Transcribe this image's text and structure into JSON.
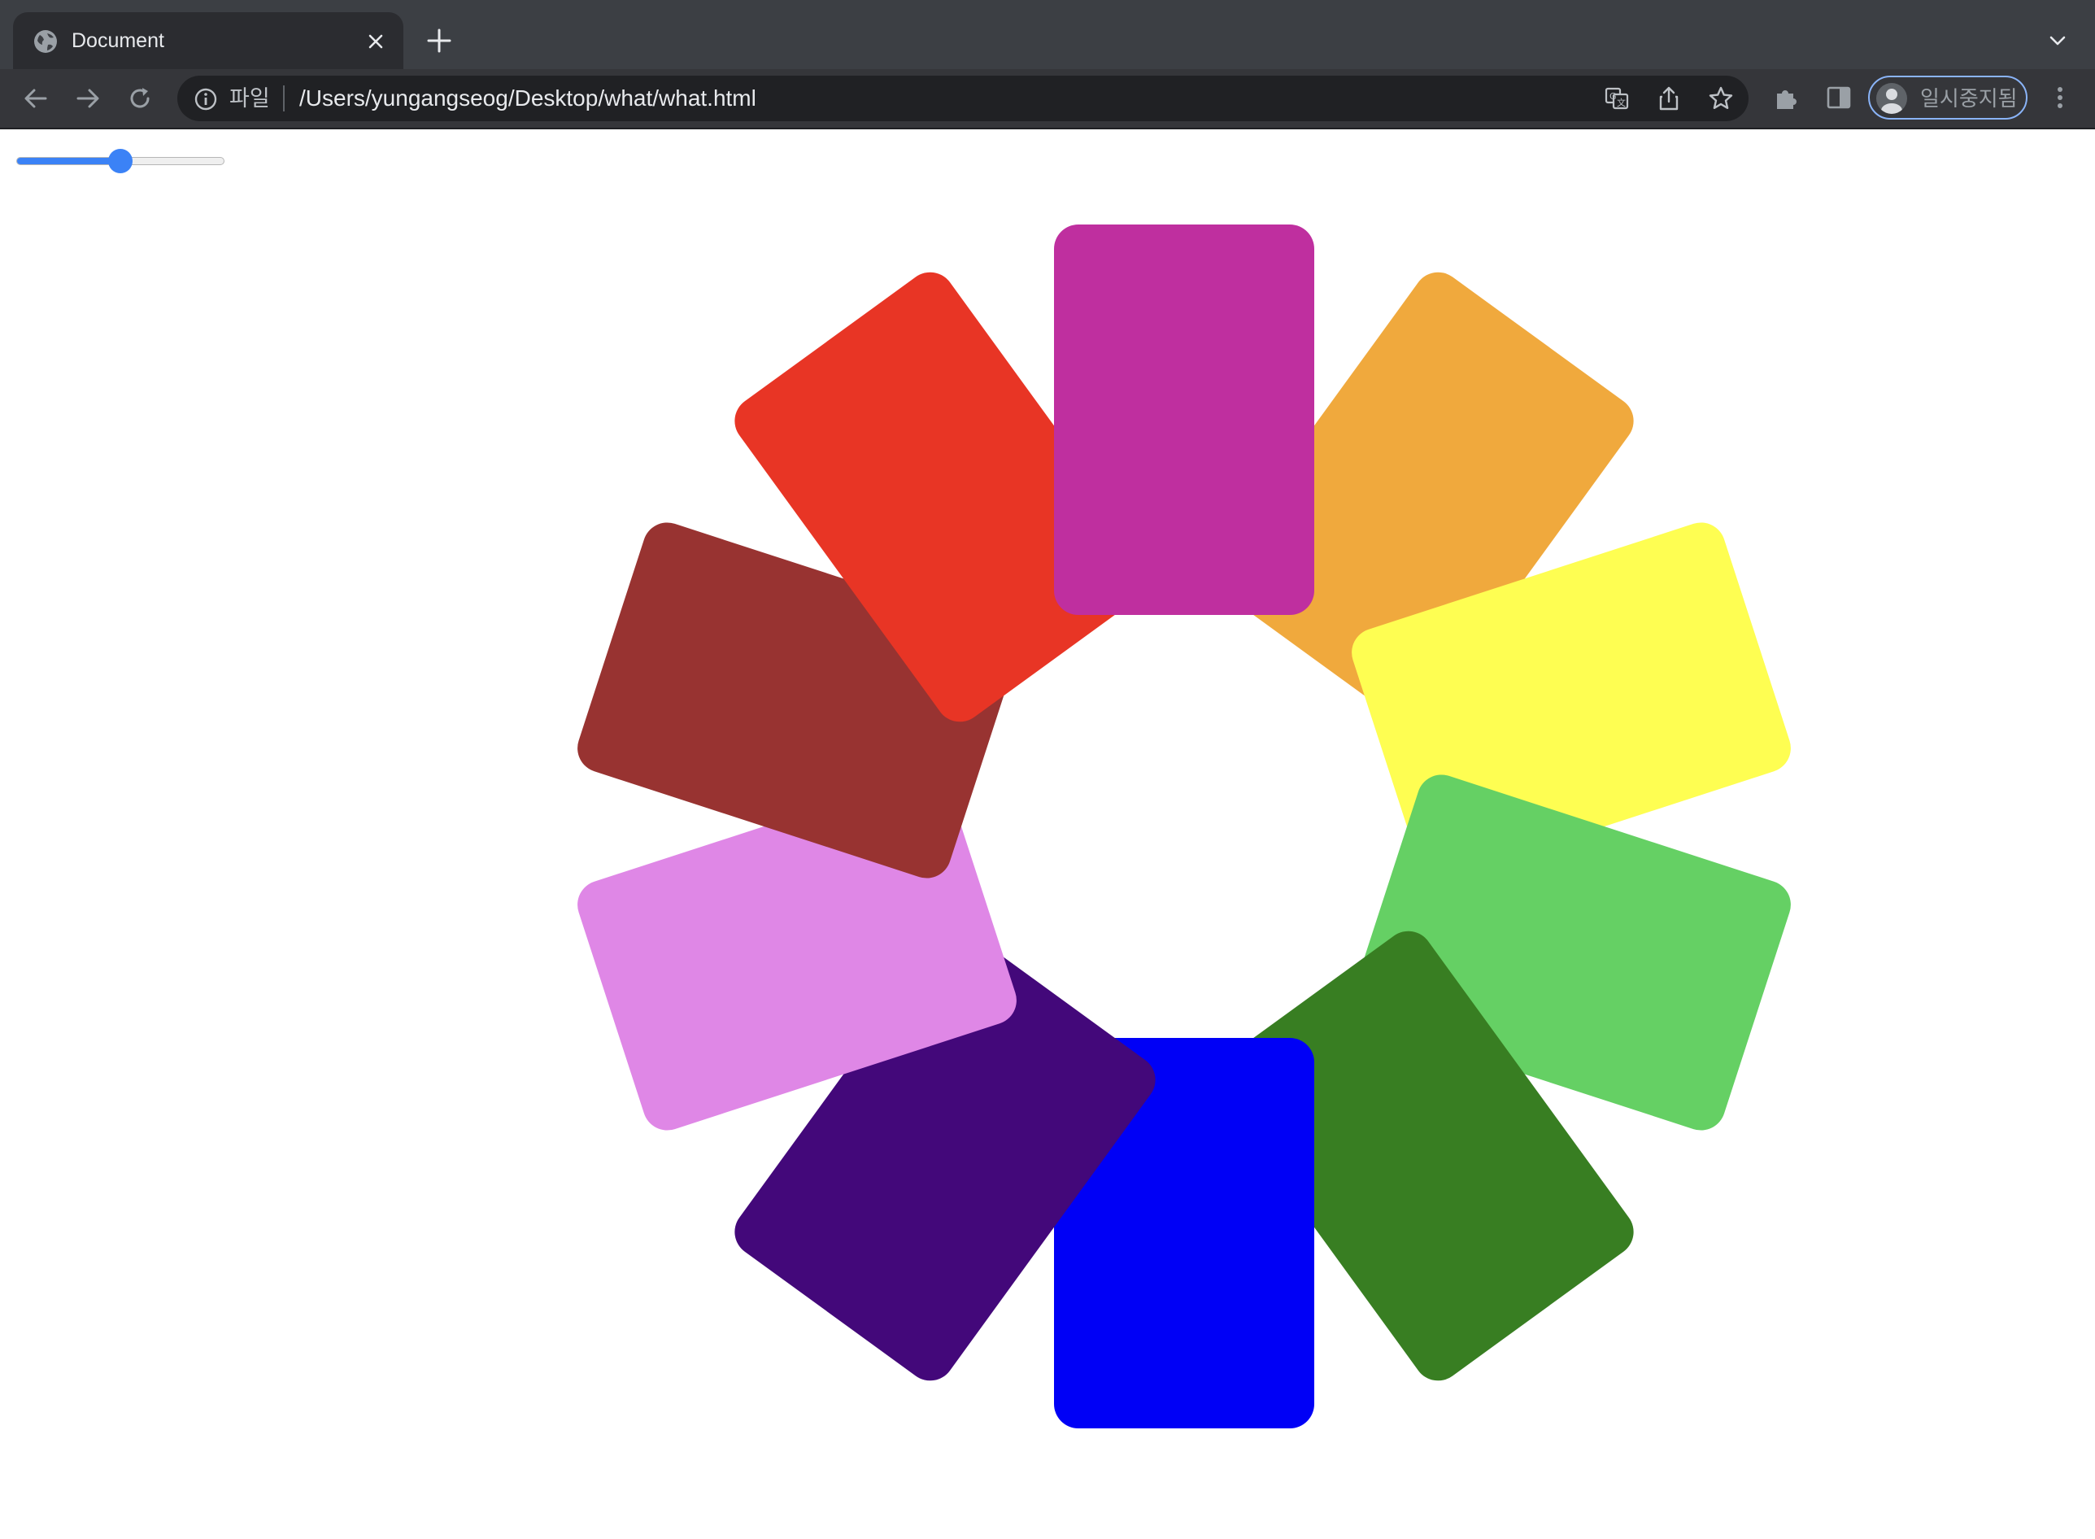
{
  "browser": {
    "tab": {
      "title": "Document"
    },
    "address": {
      "scheme_label": "파일",
      "url": "/Users/yungangseog/Desktop/what/what.html"
    },
    "profile": {
      "label": "일시중지됨"
    }
  },
  "page": {
    "slider": {
      "value_fraction": 0.5
    },
    "cards": [
      {
        "color": "#bf2f9f"
      },
      {
        "color": "#f0a93d"
      },
      {
        "color": "#fefe52"
      },
      {
        "color": "#65d064"
      },
      {
        "color": "#387e22"
      },
      {
        "color": "#0000f6"
      },
      {
        "color": "#43087a"
      },
      {
        "color": "#df87e6"
      },
      {
        "color": "#983331"
      },
      {
        "color": "#e83525"
      }
    ]
  }
}
